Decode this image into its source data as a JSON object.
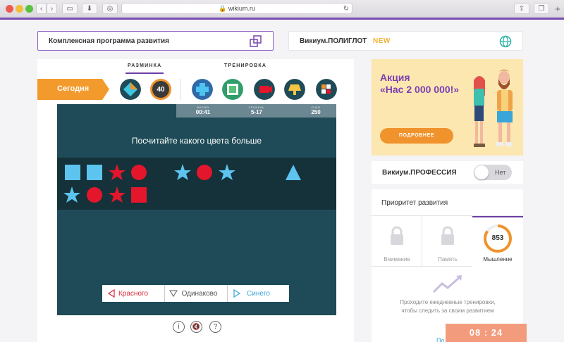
{
  "browser": {
    "url": "wikium.ru",
    "colors": {
      "close": "#ee5a52",
      "minimize": "#f4bd3b",
      "zoom": "#58c140",
      "accent": "#7d4fb4"
    }
  },
  "header": {
    "program_label": "Комплексная программа развития",
    "program_icon": "windows-icon",
    "polyglot_label": "Викиум.ПОЛИГЛОТ",
    "polyglot_badge": "NEW",
    "polyglot_icon": "globe-icon"
  },
  "main": {
    "tabs": [
      {
        "label": "РАЗМИНКА",
        "active": true
      },
      {
        "label": "ТРЕНИРОВКА",
        "active": false
      }
    ],
    "today_label": "Сегодня",
    "warmup_icons": [
      "diamond-game-icon",
      "level-40-icon"
    ],
    "warmup_level": "40",
    "training_icons": [
      "plus-game-icon",
      "frame-game-icon",
      "camera-game-icon",
      "lamp-game-icon",
      "grid-game-icon"
    ]
  },
  "game": {
    "stats": [
      {
        "key": "ВРЕМЯ",
        "value": "00:41"
      },
      {
        "key": "УРОВЕНЬ",
        "value": "5-17"
      },
      {
        "key": "ОЧКИ",
        "value": "250"
      }
    ],
    "question": "Посчитайте какого цвета больше",
    "answers": [
      {
        "label": "Красного",
        "color": "#d92a3a"
      },
      {
        "label": "Одинаково",
        "color": "#555555"
      },
      {
        "label": "Синего",
        "color": "#3aa5d8"
      }
    ],
    "colors": {
      "blue": "#5cc4ee",
      "red": "#e3162c",
      "bg": "#1e4b57",
      "board": "#15313a"
    }
  },
  "promo": {
    "title_line1": "Акция",
    "title_line2": "«Нас 2 000 000!»",
    "button": "ПОДРОБНЕЕ"
  },
  "profession": {
    "label": "Викиум.ПРОФЕССИЯ",
    "toggle_text": "Нет"
  },
  "priority": {
    "title": "Приоритет развития",
    "tabs": [
      {
        "label": "Внимание",
        "locked": true
      },
      {
        "label": "Память",
        "locked": true
      },
      {
        "label": "Мышление",
        "score": "853"
      }
    ],
    "note": "Проходите ежедневные тренировки, чтобы следить за своим развитием",
    "link_partial": "По"
  },
  "timer": "08 : 24"
}
